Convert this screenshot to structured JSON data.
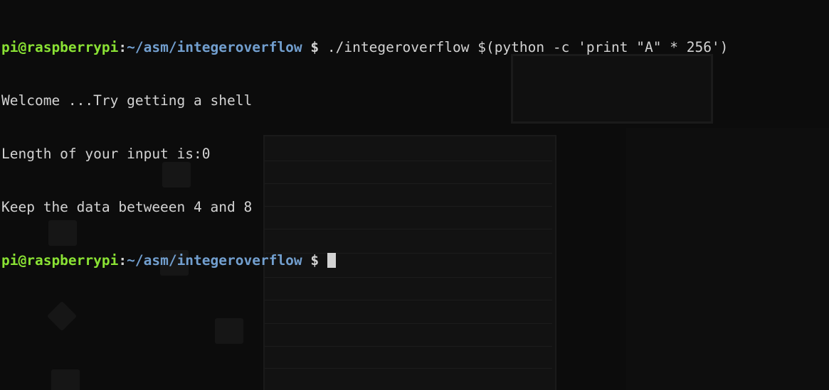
{
  "terminal": {
    "prompt_user_host": "pi@raspberrypi",
    "prompt_separator": ":",
    "prompt_path": "~/asm/integeroverflow",
    "prompt_symbol": " $",
    "command": " ./integeroverflow $(python -c 'print \"A\" * 256')",
    "output_lines": [
      "Welcome ...Try getting a shell",
      "Length of your input is:0",
      "Keep the data betweeen 4 and 8"
    ]
  },
  "colors": {
    "user_host": "#8ae234",
    "path": "#729fcf",
    "text": "#d3d3d3",
    "background": "#0c0c0c"
  }
}
